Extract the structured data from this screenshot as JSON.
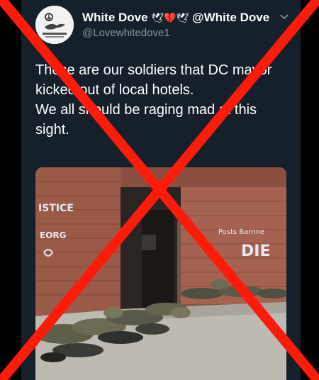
{
  "tweet": {
    "display_name": "White Dove",
    "name_emojis": [
      "dove-emoji",
      "broken-heart-emoji",
      "dove-emoji"
    ],
    "name_suffix": "@White Dove",
    "handle": "@Lovewhitedove1",
    "text": "These are our soldiers that DC mayor kicked out of local hotels.\nWe all should be raging mad at this sight.",
    "photo_graffiti": [
      "ISTICE",
      "EORG",
      "Posts Barnne",
      "DIE"
    ]
  },
  "colors": {
    "card_background": "#15202b",
    "text_primary": "#ffffff",
    "text_secondary": "#8899a6",
    "overlay_x": "#ff1a0a",
    "heart": "#e0245e"
  },
  "icons": {
    "avatar": "white-dove-avatar-icon",
    "menu": "chevron-down-icon",
    "overlay": "red-x-cross-icon"
  }
}
